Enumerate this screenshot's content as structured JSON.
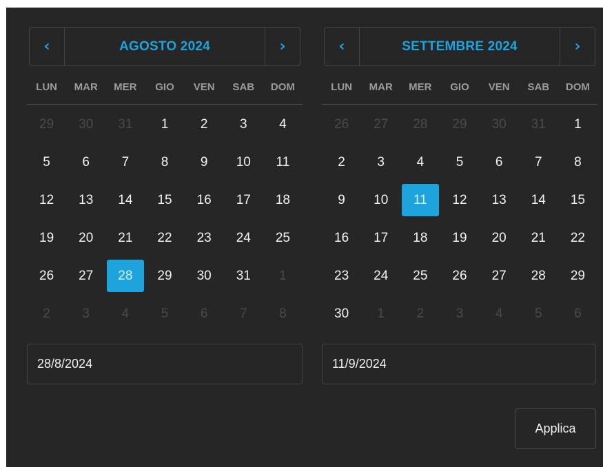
{
  "colors": {
    "accent": "#1ea4dd",
    "background": "#262626",
    "border": "#454545",
    "muted_text": "#4a4a4a"
  },
  "icons": {
    "prev": "‹",
    "next": "›"
  },
  "calendars": [
    {
      "title": "AGOSTO 2024",
      "weekdays": [
        "LUN",
        "MAR",
        "MER",
        "GIO",
        "VEN",
        "SAB",
        "DOM"
      ],
      "selected_index": 30,
      "days": [
        {
          "n": "29",
          "o": 1
        },
        {
          "n": "30",
          "o": 1
        },
        {
          "n": "31",
          "o": 1
        },
        {
          "n": "1",
          "o": 0
        },
        {
          "n": "2",
          "o": 0
        },
        {
          "n": "3",
          "o": 0
        },
        {
          "n": "4",
          "o": 0
        },
        {
          "n": "5",
          "o": 0
        },
        {
          "n": "6",
          "o": 0
        },
        {
          "n": "7",
          "o": 0
        },
        {
          "n": "8",
          "o": 0
        },
        {
          "n": "9",
          "o": 0
        },
        {
          "n": "10",
          "o": 0
        },
        {
          "n": "11",
          "o": 0
        },
        {
          "n": "12",
          "o": 0
        },
        {
          "n": "13",
          "o": 0
        },
        {
          "n": "14",
          "o": 0
        },
        {
          "n": "15",
          "o": 0
        },
        {
          "n": "16",
          "o": 0
        },
        {
          "n": "17",
          "o": 0
        },
        {
          "n": "18",
          "o": 0
        },
        {
          "n": "19",
          "o": 0
        },
        {
          "n": "20",
          "o": 0
        },
        {
          "n": "21",
          "o": 0
        },
        {
          "n": "22",
          "o": 0
        },
        {
          "n": "23",
          "o": 0
        },
        {
          "n": "24",
          "o": 0
        },
        {
          "n": "25",
          "o": 0
        },
        {
          "n": "26",
          "o": 0
        },
        {
          "n": "27",
          "o": 0
        },
        {
          "n": "28",
          "o": 0
        },
        {
          "n": "29",
          "o": 0
        },
        {
          "n": "30",
          "o": 0
        },
        {
          "n": "31",
          "o": 0
        },
        {
          "n": "1",
          "o": 1
        },
        {
          "n": "2",
          "o": 1
        },
        {
          "n": "3",
          "o": 1
        },
        {
          "n": "4",
          "o": 1
        },
        {
          "n": "5",
          "o": 1
        },
        {
          "n": "6",
          "o": 1
        },
        {
          "n": "7",
          "o": 1
        },
        {
          "n": "8",
          "o": 1
        }
      ],
      "input_value": "28/8/2024"
    },
    {
      "title": "SETTEMBRE 2024",
      "weekdays": [
        "LUN",
        "MAR",
        "MER",
        "GIO",
        "VEN",
        "SAB",
        "DOM"
      ],
      "selected_index": 16,
      "days": [
        {
          "n": "26",
          "o": 1
        },
        {
          "n": "27",
          "o": 1
        },
        {
          "n": "28",
          "o": 1
        },
        {
          "n": "29",
          "o": 1
        },
        {
          "n": "30",
          "o": 1
        },
        {
          "n": "31",
          "o": 1
        },
        {
          "n": "1",
          "o": 0
        },
        {
          "n": "2",
          "o": 0
        },
        {
          "n": "3",
          "o": 0
        },
        {
          "n": "4",
          "o": 0
        },
        {
          "n": "5",
          "o": 0
        },
        {
          "n": "6",
          "o": 0
        },
        {
          "n": "7",
          "o": 0
        },
        {
          "n": "8",
          "o": 0
        },
        {
          "n": "9",
          "o": 0
        },
        {
          "n": "10",
          "o": 0
        },
        {
          "n": "11",
          "o": 0
        },
        {
          "n": "12",
          "o": 0
        },
        {
          "n": "13",
          "o": 0
        },
        {
          "n": "14",
          "o": 0
        },
        {
          "n": "15",
          "o": 0
        },
        {
          "n": "16",
          "o": 0
        },
        {
          "n": "17",
          "o": 0
        },
        {
          "n": "18",
          "o": 0
        },
        {
          "n": "19",
          "o": 0
        },
        {
          "n": "20",
          "o": 0
        },
        {
          "n": "21",
          "o": 0
        },
        {
          "n": "22",
          "o": 0
        },
        {
          "n": "23",
          "o": 0
        },
        {
          "n": "24",
          "o": 0
        },
        {
          "n": "25",
          "o": 0
        },
        {
          "n": "26",
          "o": 0
        },
        {
          "n": "27",
          "o": 0
        },
        {
          "n": "28",
          "o": 0
        },
        {
          "n": "29",
          "o": 0
        },
        {
          "n": "30",
          "o": 0
        },
        {
          "n": "1",
          "o": 1
        },
        {
          "n": "2",
          "o": 1
        },
        {
          "n": "3",
          "o": 1
        },
        {
          "n": "4",
          "o": 1
        },
        {
          "n": "5",
          "o": 1
        },
        {
          "n": "6",
          "o": 1
        }
      ],
      "input_value": "11/9/2024"
    }
  ],
  "apply_label": "Applica"
}
